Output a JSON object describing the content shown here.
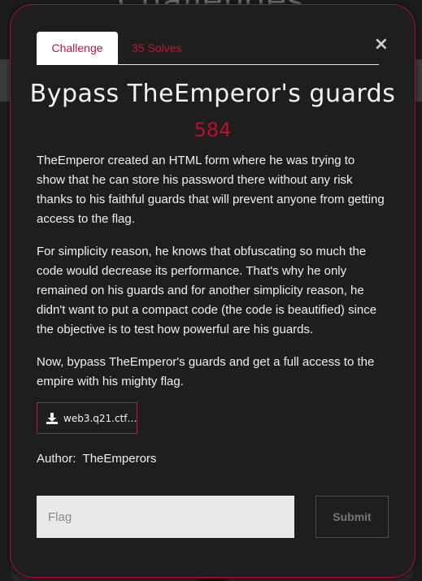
{
  "background": {
    "page_title": "Challenges"
  },
  "modal": {
    "tabs": {
      "challenge": "Challenge",
      "solves": "35 Solves"
    },
    "close_symbol": "×",
    "title": "Bypass TheEmperor's guards",
    "points": "584",
    "description": [
      "TheEmperor created an HTML form where he was trying to show that he can store his password there without any risk thanks to his faithful guards that will prevent anyone from getting access to the flag.",
      "For simplicity reason, he knows that obfuscating so much the code would decrease its performance. That's why he only remained on his guards and for another simplicity reason, he didn't want to put a compact code (the code is beautified) since the objective is to test how powerful are his guards.",
      "Now, bypass TheEmperor's guards and get a full access to the empire with his mighty flag."
    ],
    "file": {
      "label": "web3.q21.ctf…",
      "icon": "download-icon"
    },
    "author_label": "Author:",
    "author_value": "TheEmperors",
    "flag_placeholder": "Flag",
    "submit_label": "Submit"
  },
  "colors": {
    "accent": "#c4153b",
    "modal_bg": "#1e1e1e",
    "modal_border": "#b01030"
  }
}
